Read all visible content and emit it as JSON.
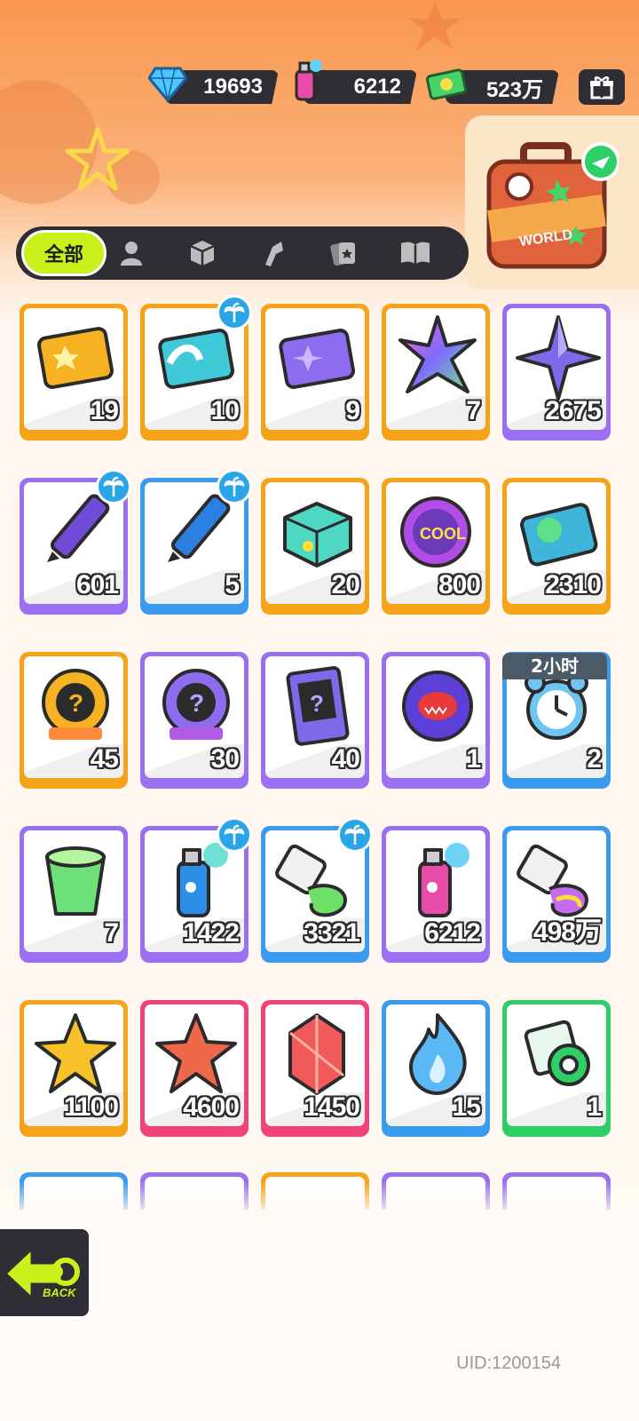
{
  "currencies": {
    "gems": {
      "value": "19693",
      "icon": "diamond-icon",
      "color": "#33b5f5"
    },
    "paint": {
      "value": "6212",
      "icon": "spray-can-icon",
      "color": "#e84ca8"
    },
    "cash": {
      "value": "523万",
      "icon": "money-icon",
      "color": "#35c45a"
    }
  },
  "gift_icon": "gift-box-icon",
  "world_card": {
    "label": "WORLD"
  },
  "tabs": {
    "all_label": "全部",
    "icons": [
      "person-icon",
      "box-icon",
      "tool-icon",
      "cards-icon",
      "book-icon"
    ]
  },
  "timer_badge": "2小时",
  "items": [
    {
      "name": "gold-ticket",
      "qty": "19",
      "border": "#f5a318",
      "palm": false
    },
    {
      "name": "wave-up-ticket",
      "qty": "10",
      "border": "#f5a318",
      "palm": true
    },
    {
      "name": "purple-star-ticket",
      "qty": "9",
      "border": "#f5a318",
      "palm": false
    },
    {
      "name": "rainbow-star",
      "qty": "7",
      "border": "#f5a318",
      "palm": false
    },
    {
      "name": "purple-star",
      "qty": "2675",
      "border": "#9a6ff0",
      "palm": false
    },
    {
      "name": "purple-crayon",
      "qty": "601",
      "border": "#9a6ff0",
      "palm": true
    },
    {
      "name": "blue-crayon",
      "qty": "5",
      "border": "#3a9bef",
      "palm": true
    },
    {
      "name": "color-brick",
      "qty": "20",
      "border": "#f5a318",
      "palm": false
    },
    {
      "name": "cool-badge",
      "qty": "800",
      "border": "#f5a318",
      "palm": false
    },
    {
      "name": "season-ticket",
      "qty": "2310",
      "border": "#f5a318",
      "palm": false
    },
    {
      "name": "gold-mystery-badge",
      "qty": "45",
      "border": "#f5a318",
      "palm": false
    },
    {
      "name": "purple-mystery-badge",
      "qty": "30",
      "border": "#9a6ff0",
      "palm": false
    },
    {
      "name": "travel-mystery-card",
      "qty": "40",
      "border": "#9a6ff0",
      "palm": false
    },
    {
      "name": "piranha-badge",
      "qty": "1",
      "border": "#9a6ff0",
      "palm": false
    },
    {
      "name": "alarm-clock",
      "qty": "2",
      "border": "#3a9bef",
      "palm": false
    },
    {
      "name": "jelly-cup",
      "qty": "7",
      "border": "#9a6ff0",
      "palm": false
    },
    {
      "name": "blue-spray-can",
      "qty": "1422",
      "border": "#9a6ff0",
      "palm": true
    },
    {
      "name": "paint-tube",
      "qty": "3321",
      "border": "#3a9bef",
      "palm": true
    },
    {
      "name": "pink-spray-can",
      "qty": "6212",
      "border": "#9a6ff0",
      "palm": false
    },
    {
      "name": "rainbow-paint-tube",
      "qty": "498万",
      "border": "#3a9bef",
      "palm": false
    },
    {
      "name": "gold-crystal",
      "qty": "1100",
      "border": "#f5a318",
      "palm": false
    },
    {
      "name": "red-crystal",
      "qty": "4600",
      "border": "#f0437a",
      "palm": false
    },
    {
      "name": "red-gem",
      "qty": "1450",
      "border": "#f0437a",
      "palm": false
    },
    {
      "name": "blue-flame",
      "qty": "15",
      "border": "#3a9bef",
      "palm": false
    },
    {
      "name": "green-tape",
      "qty": "1",
      "border": "#2fcf67",
      "palm": false
    },
    {
      "name": "partial-item-1",
      "qty": "",
      "border": "#3a9bef",
      "palm": false
    },
    {
      "name": "partial-item-2",
      "qty": "",
      "border": "#9a6ff0",
      "palm": false
    },
    {
      "name": "partial-item-3",
      "qty": "",
      "border": "#f5a318",
      "palm": false
    },
    {
      "name": "partial-item-4",
      "qty": "",
      "border": "#9a6ff0",
      "palm": false
    },
    {
      "name": "partial-item-5",
      "qty": "",
      "border": "#9a6ff0",
      "palm": false
    }
  ],
  "back_label": "BACK",
  "uid": "UID:1200154"
}
